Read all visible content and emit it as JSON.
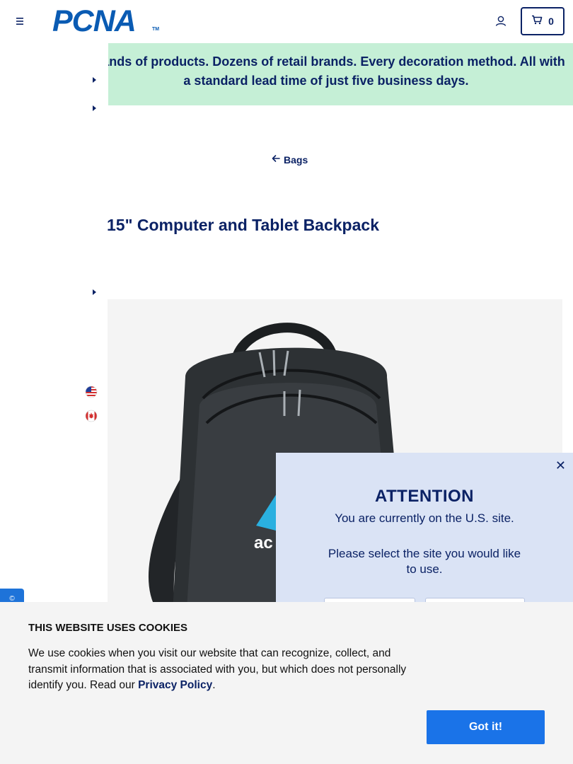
{
  "header": {
    "logo_text": "PCNA",
    "logo_tm": "TM",
    "cart_count": "0",
    "icons": [
      "hamburger-menu-icon",
      "user-icon",
      "cart-icon"
    ]
  },
  "banner": {
    "text": "usands of products. Dozens of retail brands. Every decoration method. All with a standard lead time of just five business days."
  },
  "breadcrumb": {
    "back_label": "Bags"
  },
  "product": {
    "title": "15\" Computer and Tablet Backpack",
    "logo_text": "ac"
  },
  "side_tab": {
    "label": "©"
  },
  "modal": {
    "close_label": "✕",
    "title": "ATTENTION",
    "message": "You are currently on the U.S. site.",
    "prompt": "Please select the site you would like to use."
  },
  "cookie": {
    "title": "THIS WEBSITE USES COOKIES",
    "text": "We use cookies when you visit our website that can recognize, collect, and transmit information that is associated with you, but which does not personally identify you. Read our ",
    "link_label": "Privacy Policy",
    "period": ".",
    "button_label": "Got it!"
  },
  "colors": {
    "brand_navy": "#0b2265",
    "brand_blue": "#0a5bb3",
    "banner_green": "#c5efd6",
    "modal_bg": "#dae3f5",
    "cookie_button": "#1a73e8"
  }
}
